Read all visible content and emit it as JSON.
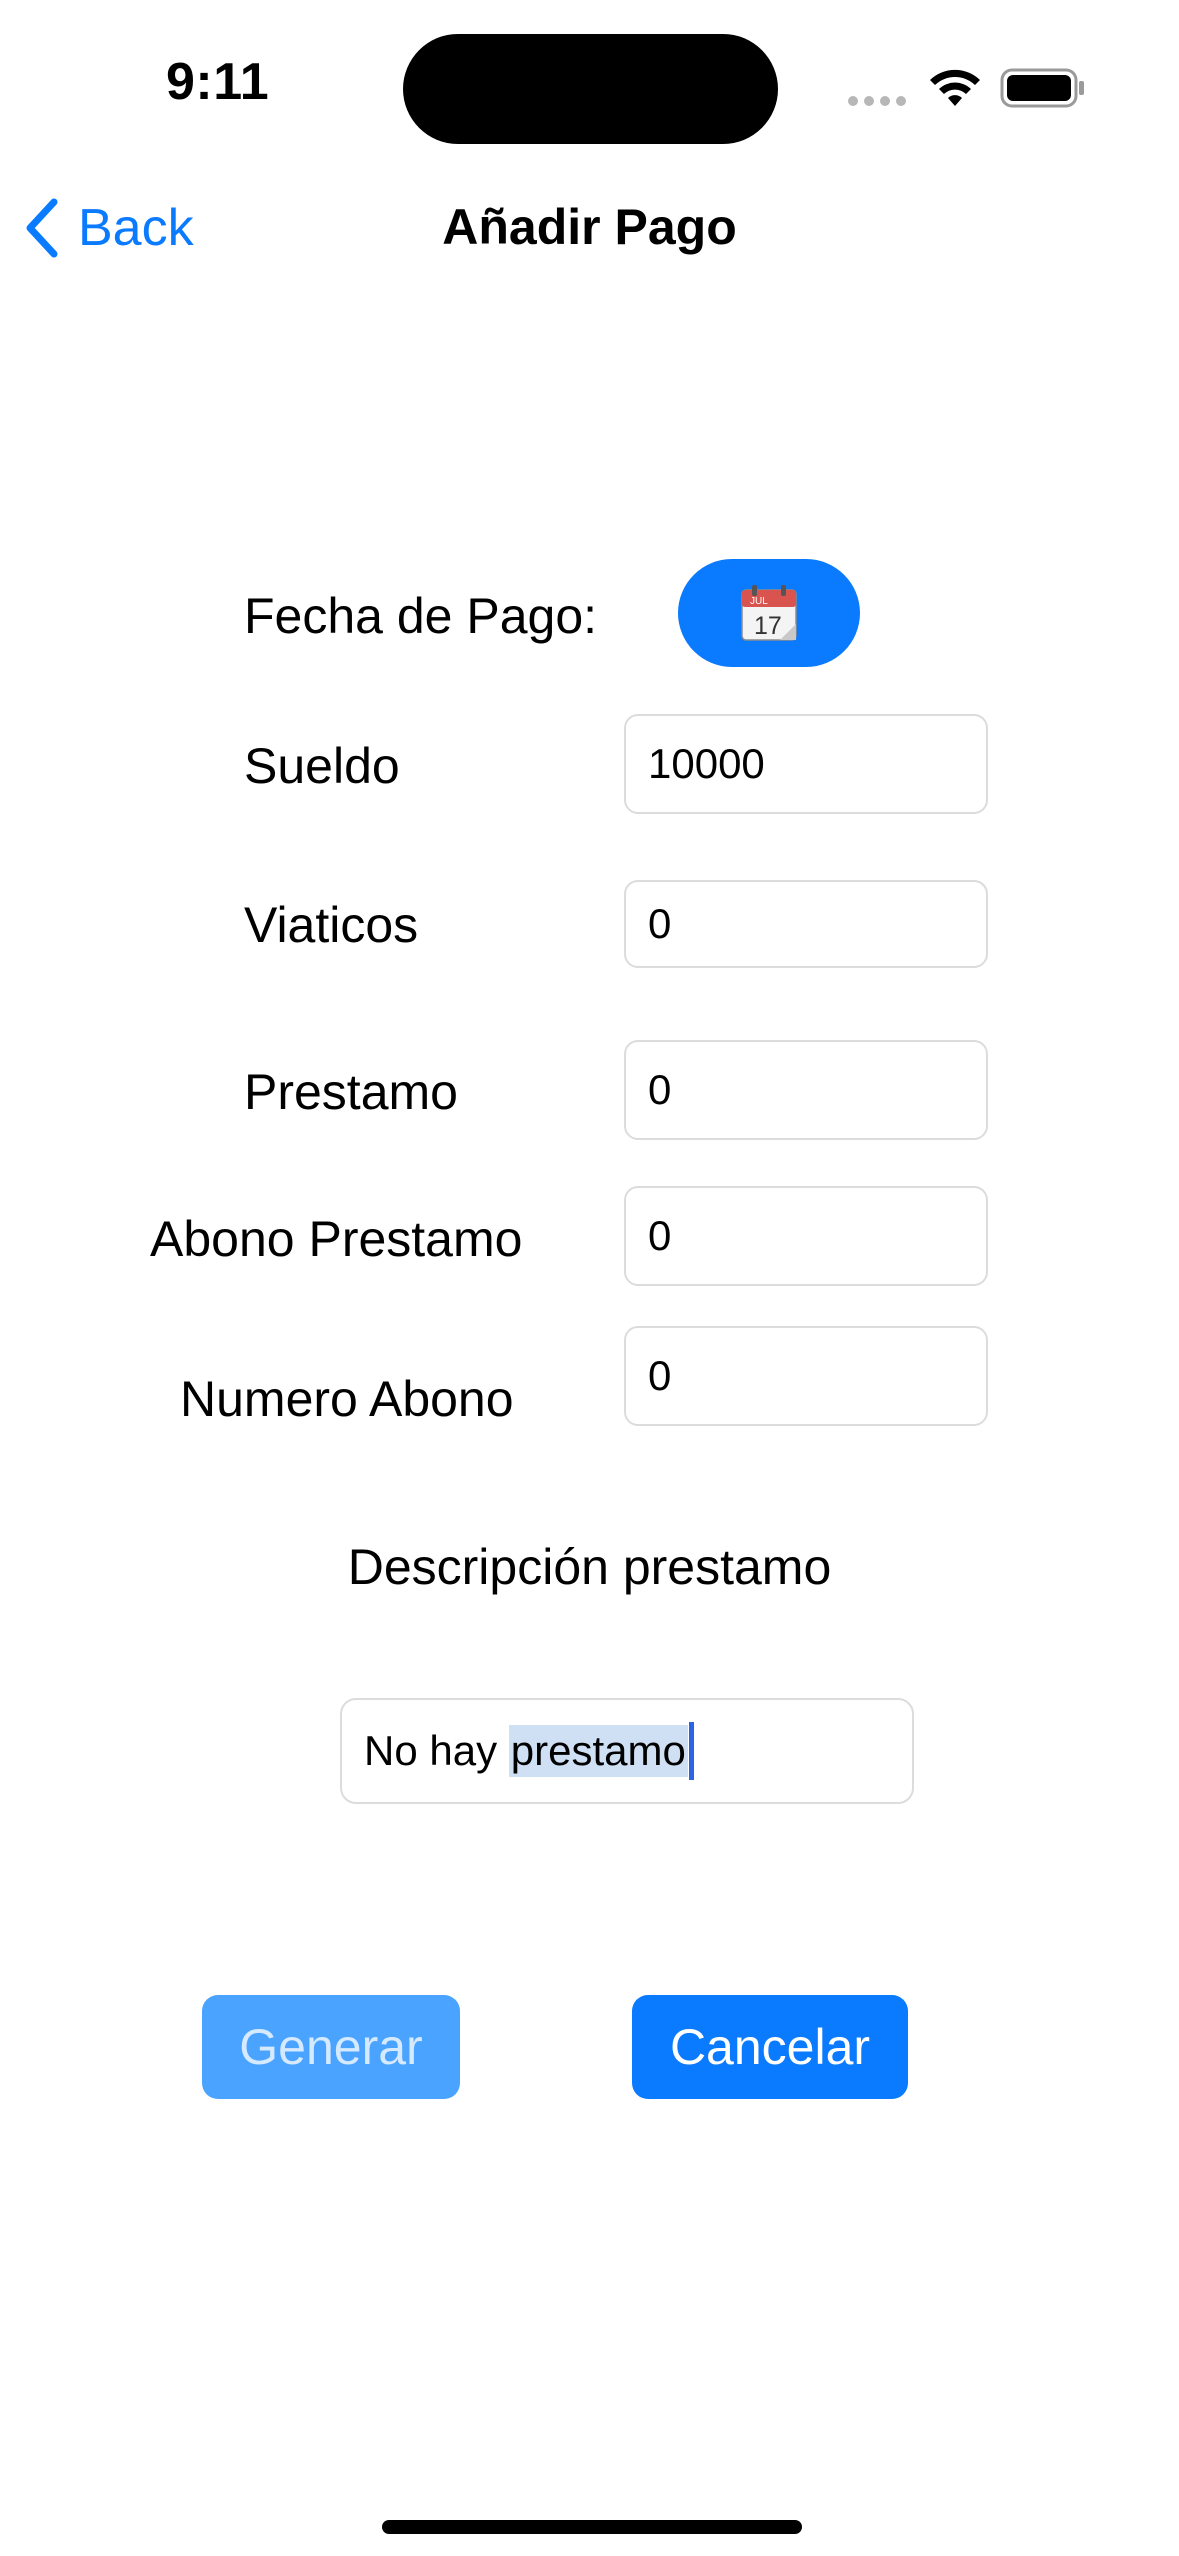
{
  "status_bar": {
    "time": "9:11"
  },
  "nav": {
    "back_label": "Back",
    "title": "Añadir Pago"
  },
  "form": {
    "fecha_label": "Fecha de Pago:",
    "date_button_icon": "calendar-icon",
    "calendar_month": "JUL",
    "calendar_day": "17",
    "fields": [
      {
        "label": "Sueldo",
        "value": "10000"
      },
      {
        "label": "Viaticos",
        "value": "0"
      },
      {
        "label": "Prestamo",
        "value": "0"
      },
      {
        "label": "Abono Prestamo",
        "value": "0"
      },
      {
        "label": "Numero Abono",
        "value": "0"
      }
    ],
    "description_title": "Descripción prestamo",
    "description_value_plain": "No hay ",
    "description_value_selected": "prestamo"
  },
  "buttons": {
    "generar": "Generar",
    "cancelar": "Cancelar"
  },
  "colors": {
    "accent": "#0a7aff",
    "disabled_button": "#4aa3ff",
    "selection": "#cfe0f5"
  }
}
